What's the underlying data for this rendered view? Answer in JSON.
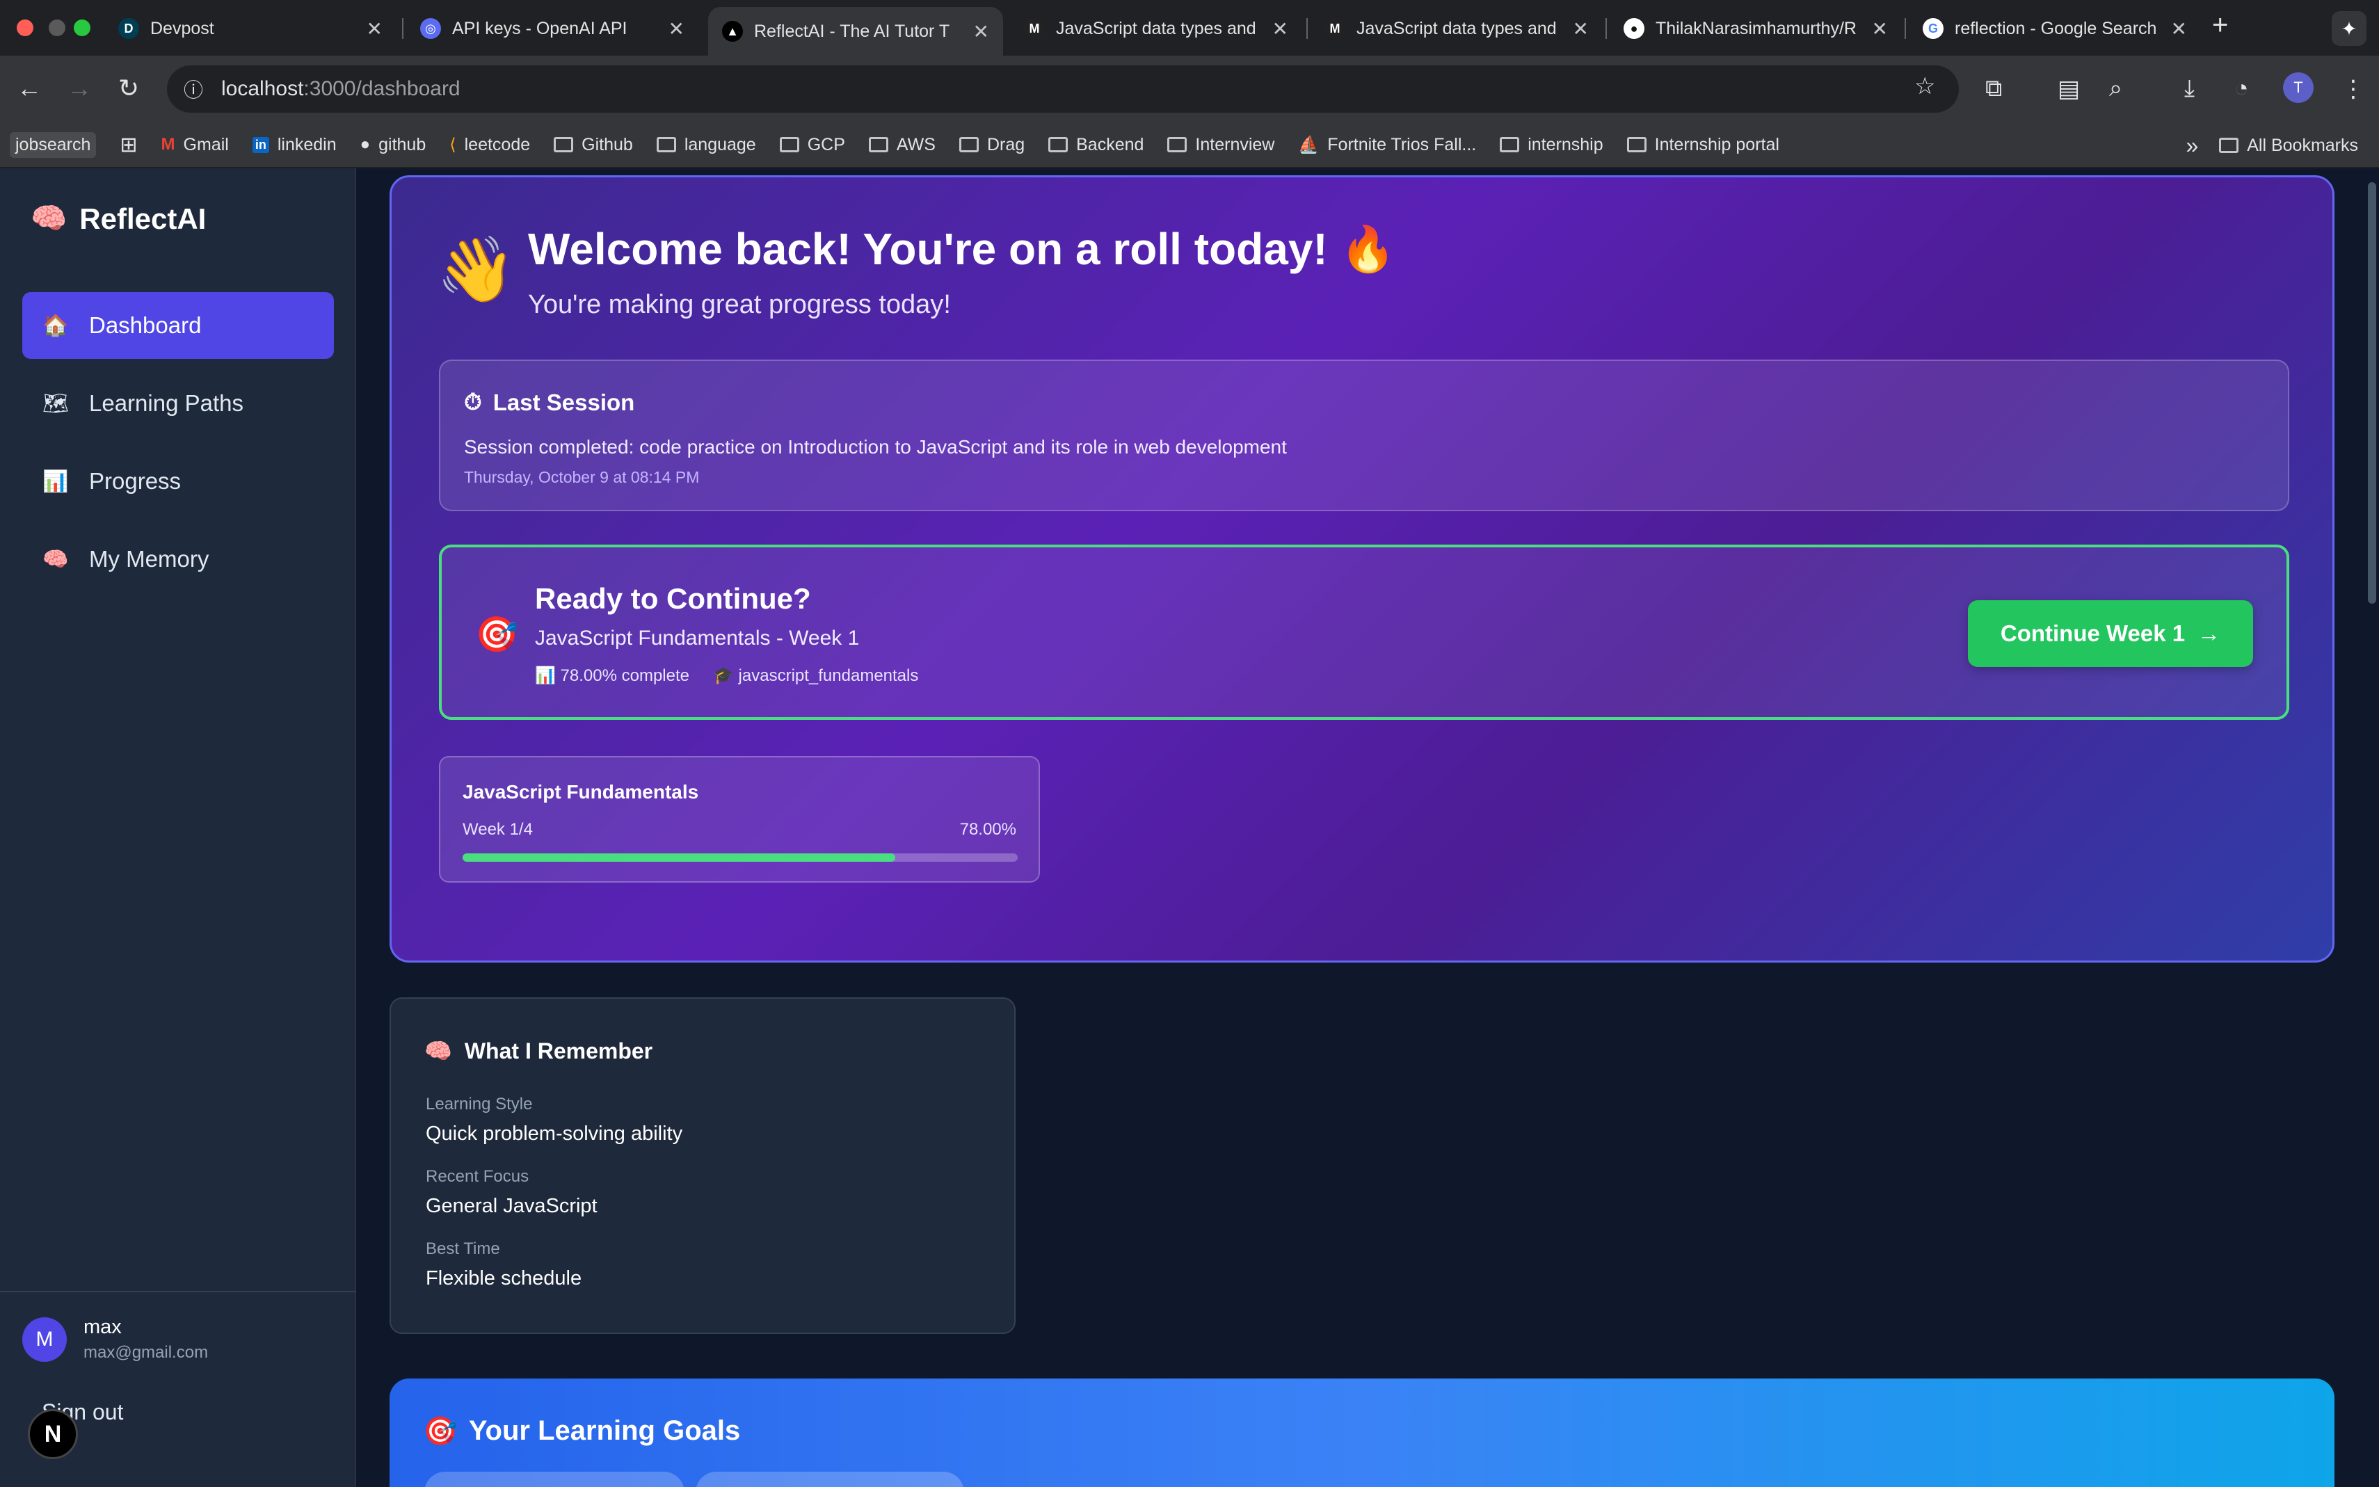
{
  "browser": {
    "tabs": [
      {
        "title": "Devpost",
        "favicon": "D",
        "favicon_color": "#003e54"
      },
      {
        "title": "API keys - OpenAI API",
        "favicon": "◎",
        "favicon_color": "#5b6cf0"
      },
      {
        "title": "ReflectAI - The AI Tutor T",
        "favicon": "▲",
        "favicon_color": "#000000",
        "active": true
      },
      {
        "title": "JavaScript data types and",
        "favicon": "M",
        "favicon_color": "#222222"
      },
      {
        "title": "JavaScript data types and",
        "favicon": "M",
        "favicon_color": "#222222"
      },
      {
        "title": "ThilakNarasimhamurthy/R",
        "favicon": "●",
        "favicon_color": "#111111"
      },
      {
        "title": "reflection - Google Search",
        "favicon": "G",
        "favicon_color": "#ffffff"
      }
    ],
    "url_host": "localhost",
    "url_path": ":3000/dashboard",
    "bookmarks": [
      {
        "label": "jobsearch",
        "type": "chip"
      },
      {
        "label": "",
        "type": "apps"
      },
      {
        "label": "Gmail",
        "type": "link",
        "icon": "M"
      },
      {
        "label": "linkedin",
        "type": "link",
        "icon": "in"
      },
      {
        "label": "github",
        "type": "link",
        "icon": "●"
      },
      {
        "label": "leetcode",
        "type": "link",
        "icon": "⟨"
      },
      {
        "label": "Github",
        "type": "folder"
      },
      {
        "label": "language",
        "type": "folder"
      },
      {
        "label": "GCP",
        "type": "folder"
      },
      {
        "label": "AWS",
        "type": "folder"
      },
      {
        "label": "Drag",
        "type": "folder"
      },
      {
        "label": "Backend",
        "type": "folder"
      },
      {
        "label": "Internview",
        "type": "folder"
      },
      {
        "label": "Fortnite Trios Fall...",
        "type": "link",
        "icon": "⛵"
      },
      {
        "label": "internship",
        "type": "folder"
      },
      {
        "label": "Internship portal",
        "type": "folder"
      }
    ],
    "more_bookmarks": "»",
    "all_bookmarks": "All Bookmarks"
  },
  "app": {
    "brand": {
      "icon": "🧠",
      "name": "ReflectAI"
    },
    "nav": [
      {
        "icon": "🏠",
        "label": "Dashboard",
        "active": true
      },
      {
        "icon": "🗺",
        "label": "Learning Paths"
      },
      {
        "icon": "📊",
        "label": "Progress"
      },
      {
        "icon": "🧠",
        "label": "My Memory"
      }
    ],
    "user": {
      "initial": "M",
      "name": "max",
      "email": "max@gmail.com"
    },
    "sign_out": "Sign out",
    "dev_badge": "N"
  },
  "hero": {
    "wave": "👋",
    "title": "Welcome back! You're on a roll today! 🔥",
    "subtitle": "You're making great progress today!",
    "last_session": {
      "icon": "⏱",
      "title": "Last Session",
      "text": "Session completed: code practice on Introduction to JavaScript and its role in web development",
      "time": "Thursday, October 9 at 08:14 PM"
    },
    "continue": {
      "icon": "🎯",
      "title": "Ready to Continue?",
      "subtitle": "JavaScript Fundamentals - Week 1",
      "complete": "📊 78.00% complete",
      "path_id": "🎓 javascript_fundamentals",
      "button": "Continue Week 1",
      "button_arrow": "→"
    },
    "path_card": {
      "title": "JavaScript Fundamentals",
      "week": "Week 1/4",
      "percent_label": "78.00%",
      "progress": 78.0,
      "bar_color": "#4ade80"
    }
  },
  "memory": {
    "icon": "🧠",
    "title": "What I Remember",
    "items": [
      {
        "label": "Learning Style",
        "value": "Quick problem-solving ability"
      },
      {
        "label": "Recent Focus",
        "value": "General JavaScript"
      },
      {
        "label": "Best Time",
        "value": "Flexible schedule"
      }
    ]
  },
  "goals": {
    "icon": "🎯",
    "title": "Your Learning Goals"
  }
}
